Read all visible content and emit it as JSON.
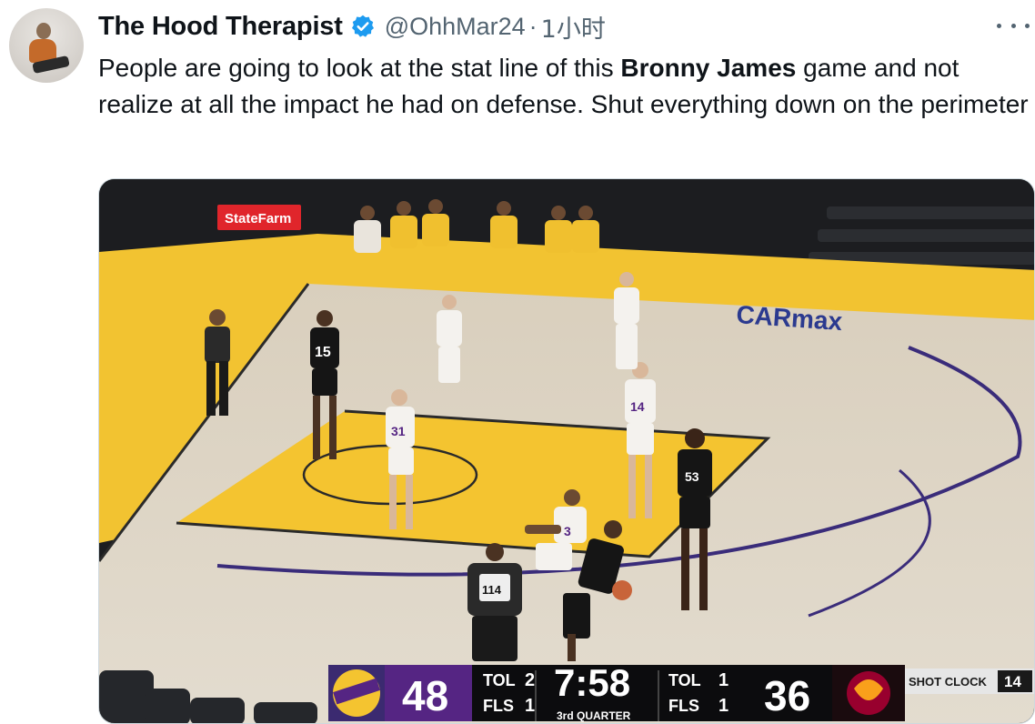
{
  "tweet": {
    "display_name": "The Hood Therapist",
    "handle": "@OhhMar24",
    "separator": "·",
    "time": "1小时",
    "text_before": "People are going to look at the stat line of this ",
    "text_bold": "Bronny James",
    "text_after": " game and not realize at all the impact he had on defense. Shut everything down on the perimeter"
  },
  "icons": {
    "avatar": "avatar-photo",
    "verified": "verified-badge-icon",
    "more": "more-options-icon"
  },
  "colors": {
    "verified_blue": "#1d9bf0",
    "court_wood": "#dcd3c3",
    "court_paint": "#f4c430",
    "lakers_purple": "#552583",
    "heat_red": "#98002e"
  },
  "video": {
    "arena_signs": {
      "statefarm": "StateFarm",
      "carmax": "CARmax"
    },
    "jerseys": {
      "heat_a": "15",
      "heat_b": "53",
      "lakers_a": "31",
      "lakers_b": "14",
      "lakers_c": "3",
      "referee": "114"
    },
    "scoreboard": {
      "home_score": "48",
      "away_score": "36",
      "team1": "TOL",
      "team1_val": "2",
      "team2": "FLS",
      "team2_val": "1",
      "clock": "7:58",
      "period": "3rd QUARTER",
      "team3": "TOL",
      "team3_val": "1",
      "team4": "FLS",
      "team4_val": "1",
      "shot_clock_label": "SHOT CLOCK",
      "shot_clock": "14"
    }
  }
}
